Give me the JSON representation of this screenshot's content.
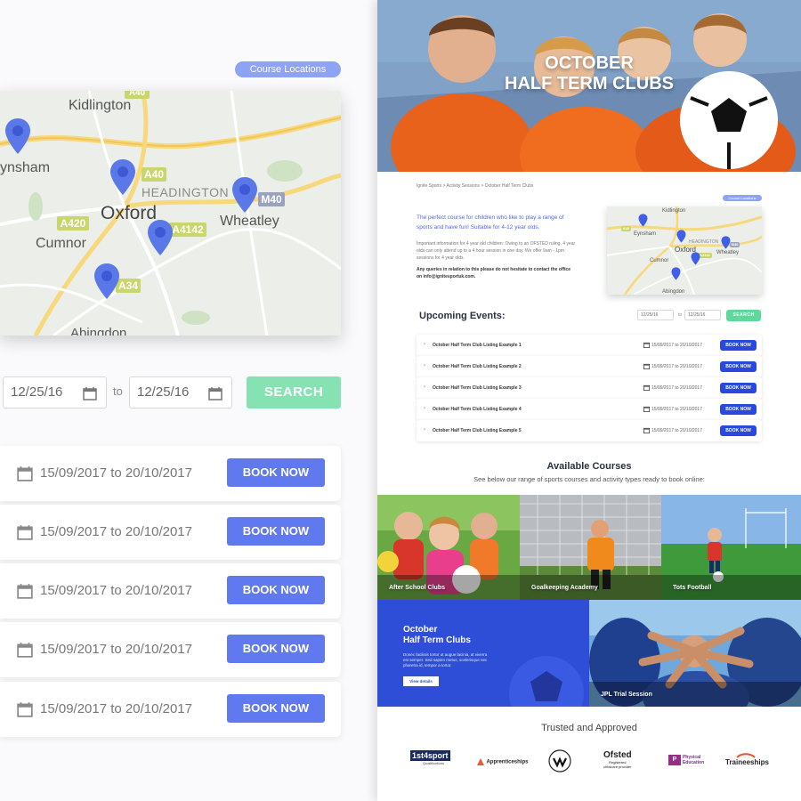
{
  "course_locations_label": "Course Locations",
  "map": {
    "towns": {
      "kidlington": "Kidlington",
      "eynsham": "ynsham",
      "eynsham_full": "Eynsham",
      "headington": "HEADINGTON",
      "oxford": "Oxford",
      "wheatley": "Wheatley",
      "cumnor": "Cumnor",
      "abingdon": "Abingdon"
    },
    "roads": {
      "a40": "A40",
      "m40": "M40",
      "a420": "A420",
      "a4142": "A4142",
      "a34": "A34"
    },
    "pin_color": "#5a78e8"
  },
  "filter": {
    "from_date": "12/25/16",
    "to_label": "to",
    "to_date": "12/25/16",
    "search_label": "SEARCH"
  },
  "breadcrumb": "Ignite Sports > Activity Sessions > October Half Term Clubs",
  "hero_title_line1": "OCTOBER",
  "hero_title_line2": "HALF TERM CLUBS",
  "intro": {
    "lead": "The perfect course for children who like to play a range of sports and have fun! Suitable for 4-12 year olds.",
    "body": "Important information for 4 year old children: Owing to an OFSTED ruling, 4 year olds can only attend up to a 4 hour session in one day. We offer 9am - 1pm sessions for 4 year olds.",
    "query": "Any queries in relation to this please do not hesitate to contact the office on info@ignitesportuk.com."
  },
  "upcoming_title": "Upcoming Events:",
  "events": [
    {
      "title": "October Half Term Club Listing Example 1",
      "dates": "15/09/2017 to 20/10/2017",
      "book": "BOOK NOW"
    },
    {
      "title": "October Half Term Club Listing Example 2",
      "dates": "15/09/2017 to 20/10/2017",
      "book": "BOOK NOW"
    },
    {
      "title": "October Half Term Club Listing Example 3",
      "dates": "15/09/2017 to 20/10/2017",
      "book": "BOOK NOW"
    },
    {
      "title": "October Half Term Club Listing Example 4",
      "dates": "15/09/2017 to 20/10/2017",
      "book": "BOOK NOW"
    },
    {
      "title": "October Half Term Club Listing Example 5",
      "dates": "15/09/2017 to 20/10/2017",
      "book": "BOOK NOW"
    }
  ],
  "available": {
    "title": "Available Courses",
    "subtitle": "See below our range of sports courses and activity types ready to book online:",
    "tiles": {
      "after_school": "After School Clubs",
      "goalkeeping": "Goalkeeping Academy",
      "tots": "Tots Football",
      "jpl": "JPL Trial Session"
    },
    "promo": {
      "title_line1": "October",
      "title_line2": "Half Term Clubs",
      "text": "Donec facilisis tortor ut augue lacinia, at viverra est semper. Sed sapien metus, scelerisque nec pharetra id, tempor a tortor.",
      "button": "View details"
    }
  },
  "trusted": {
    "title": "Trusted and Approved",
    "logos": {
      "first4sport_a": "1st4sport",
      "first4sport_b": "Qualifications",
      "apprenticeships": "Apprenticeships",
      "ofsted_a": "Ofsted",
      "ofsted_b": "Registered",
      "ofsted_c": "childcare provider",
      "afpe_a": "Physical",
      "afpe_b": "Education",
      "traineeships": "Traineeships"
    }
  },
  "colors": {
    "accent": "#6179ee",
    "book_small": "#2848e0",
    "search_green": "#86e2b3",
    "pill": "#8fa3f5",
    "promo_blue": "#2f4ed8"
  }
}
